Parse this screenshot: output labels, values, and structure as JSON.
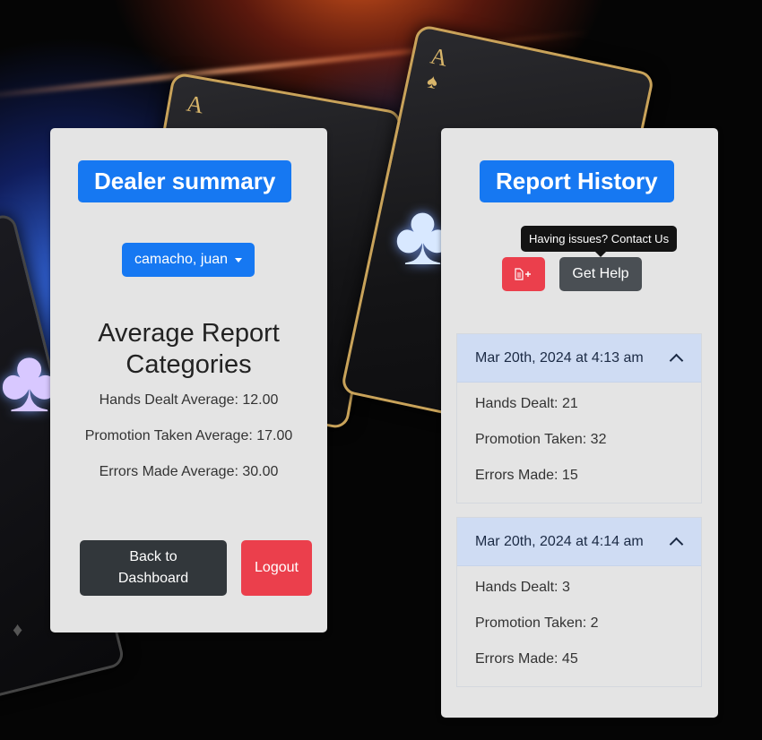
{
  "left_panel": {
    "title": "Dealer summary",
    "dealer_select": "camacho, juan",
    "heading_line1": "Average Report",
    "heading_line2": "Categories",
    "averages": [
      "Hands Dealt Average: 12.00",
      "Promotion Taken Average: 17.00",
      "Errors Made Average: 30.00"
    ],
    "back_button_line1": "Back to",
    "back_button_line2": "Dashboard",
    "logout_label": "Logout"
  },
  "right_panel": {
    "title": "Report History",
    "tooltip": "Having issues? Contact Us",
    "add_report_icon": "file-plus-icon",
    "help_label": "Get Help",
    "reports": [
      {
        "date": "Mar 20th, 2024 at 4:13 am",
        "lines": [
          "Hands Dealt: 21",
          "Promotion Taken: 32",
          "Errors Made: 15"
        ]
      },
      {
        "date": "Mar 20th, 2024 at 4:14 am",
        "lines": [
          "Hands Dealt: 3",
          "Promotion Taken: 2",
          "Errors Made: 45"
        ]
      }
    ]
  },
  "colors": {
    "primary": "#1678f2",
    "danger": "#eb3f4c",
    "dark": "#32373b",
    "panel": "#e4e4e4",
    "accordion_header": "#cfdcf3"
  }
}
